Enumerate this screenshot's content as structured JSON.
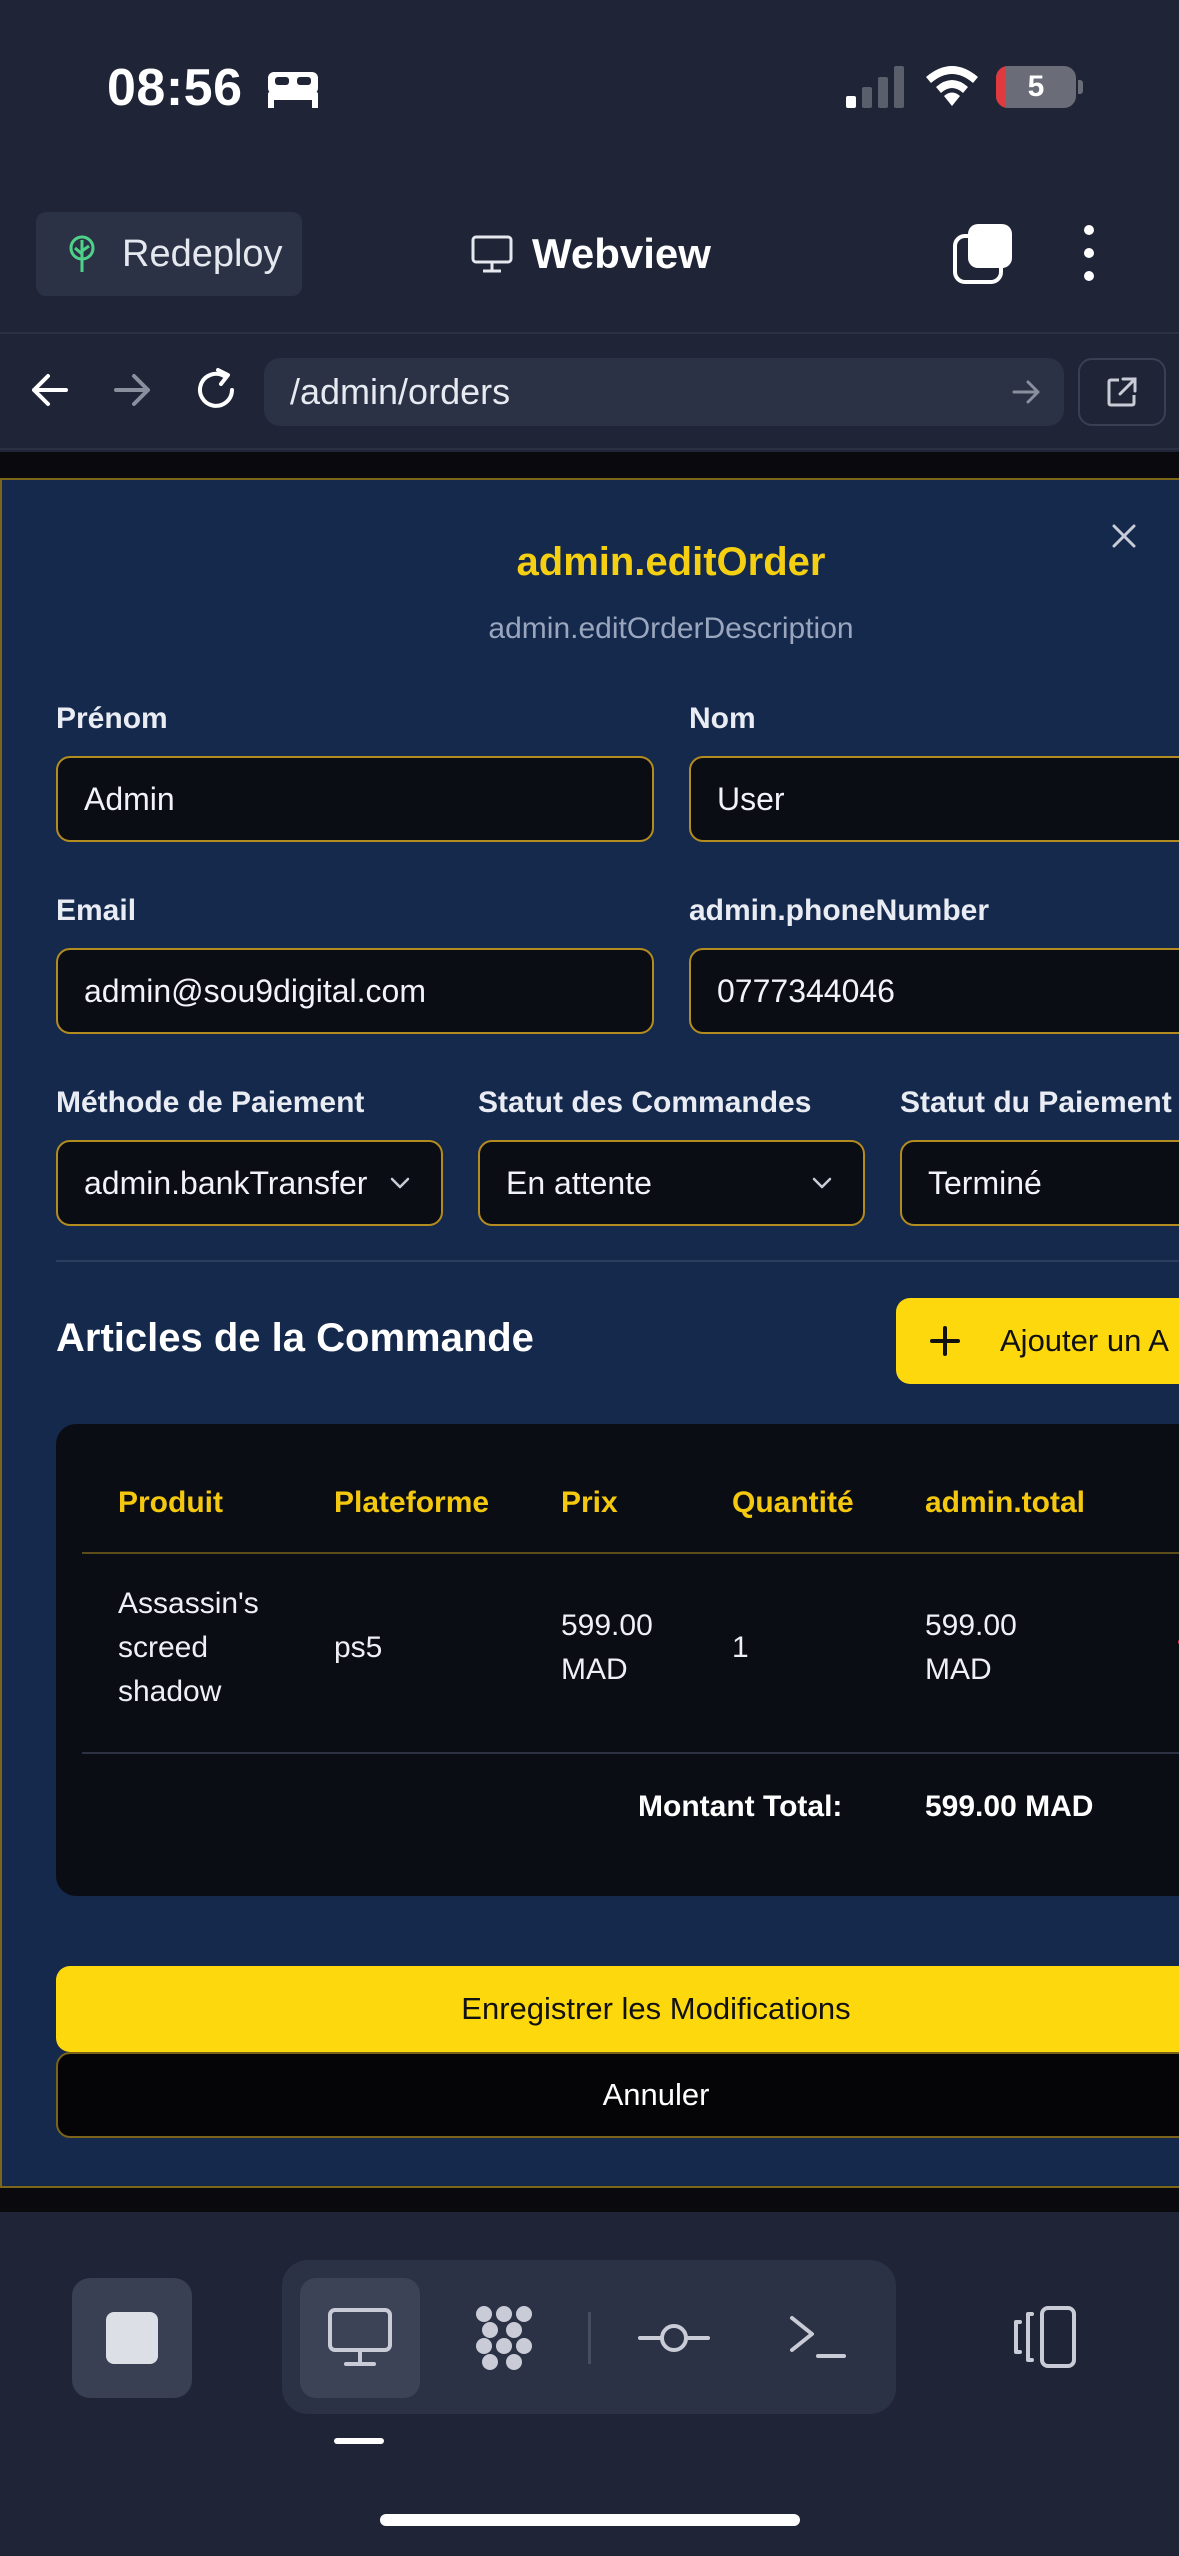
{
  "status_bar": {
    "time": "08:56",
    "battery_level": "5",
    "icons": [
      "bed-icon",
      "signal-icon",
      "wifi-icon",
      "battery-icon"
    ]
  },
  "app_header": {
    "redeploy_label": "Redeploy",
    "title": "Webview"
  },
  "nav": {
    "url": "/admin/orders"
  },
  "modal": {
    "title": "admin.editOrder",
    "description": "admin.editOrderDescription",
    "fields": {
      "first_name": {
        "label": "Prénom",
        "value": "Admin"
      },
      "last_name": {
        "label": "Nom",
        "value": "User"
      },
      "email": {
        "label": "Email",
        "value": "admin@sou9digital.com"
      },
      "phone": {
        "label": "admin.phoneNumber",
        "value": "0777344046"
      },
      "payment_method": {
        "label": "Méthode de Paiement",
        "value": "admin.bankTransfer"
      },
      "order_status": {
        "label": "Statut des Commandes",
        "value": "En attente"
      },
      "payment_status": {
        "label": "Statut du Paiement",
        "value": "Terminé"
      }
    },
    "items_section": {
      "title": "Articles de la Commande",
      "add_button": "Ajouter un A",
      "columns": [
        "Produit",
        "Plateforme",
        "Prix",
        "Quantité",
        "admin.total"
      ],
      "rows": [
        {
          "product": "Assassin's screed shadow",
          "platform": "ps5",
          "price": "599.00 MAD",
          "quantity": "1",
          "total": "599.00 MAD"
        }
      ],
      "total_label": "Montant Total:",
      "total_value": "599.00 MAD"
    },
    "save_button": "Enregistrer les Modifications",
    "cancel_button": "Annuler"
  },
  "colors": {
    "accent": "#fcd80c",
    "modal_bg": "#15294d",
    "app_bg": "#1f2436",
    "heading_yellow": "#f5cf12"
  }
}
